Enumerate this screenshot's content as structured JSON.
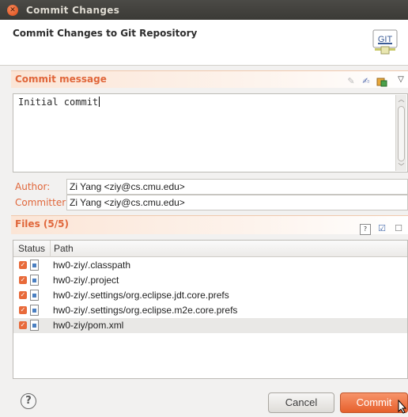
{
  "window": {
    "title": "Commit Changes",
    "close_glyph": "✕"
  },
  "header": {
    "heading": "Commit Changes to Git Repository",
    "logo_text": "GIT"
  },
  "commit_section": {
    "label": "Commit message",
    "message": "Initial commit"
  },
  "author": {
    "label": "Author:",
    "value": "Zi Yang <ziy@cs.cmu.edu>"
  },
  "committer": {
    "label": "Committer:",
    "value": "Zi Yang <ziy@cs.cmu.edu>"
  },
  "files_section": {
    "label": "Files (5/5)",
    "columns": [
      "Status",
      "Path"
    ],
    "rows": [
      {
        "path": "hw0-ziy/.classpath",
        "checked": true
      },
      {
        "path": "hw0-ziy/.project",
        "checked": true
      },
      {
        "path": "hw0-ziy/.settings/org.eclipse.jdt.core.prefs",
        "checked": true
      },
      {
        "path": "hw0-ziy/.settings/org.eclipse.m2e.core.prefs",
        "checked": true
      },
      {
        "path": "hw0-ziy/pom.xml",
        "checked": true,
        "selected": true
      }
    ]
  },
  "footer": {
    "help_glyph": "?",
    "cancel_label": "Cancel",
    "commit_label": "Commit"
  },
  "colors": {
    "accent": "#e0663a",
    "title_bar": "#3c3b37",
    "commit_button": "#ea6a36"
  },
  "icons": [
    "close-icon",
    "git-logo-icon",
    "spellcheck-icon",
    "sign-off-icon",
    "amend-icon",
    "view-menu-icon",
    "lightbulb-icon",
    "show-untracked-icon",
    "check-all-icon",
    "uncheck-all-icon",
    "file-icon",
    "help-icon"
  ]
}
